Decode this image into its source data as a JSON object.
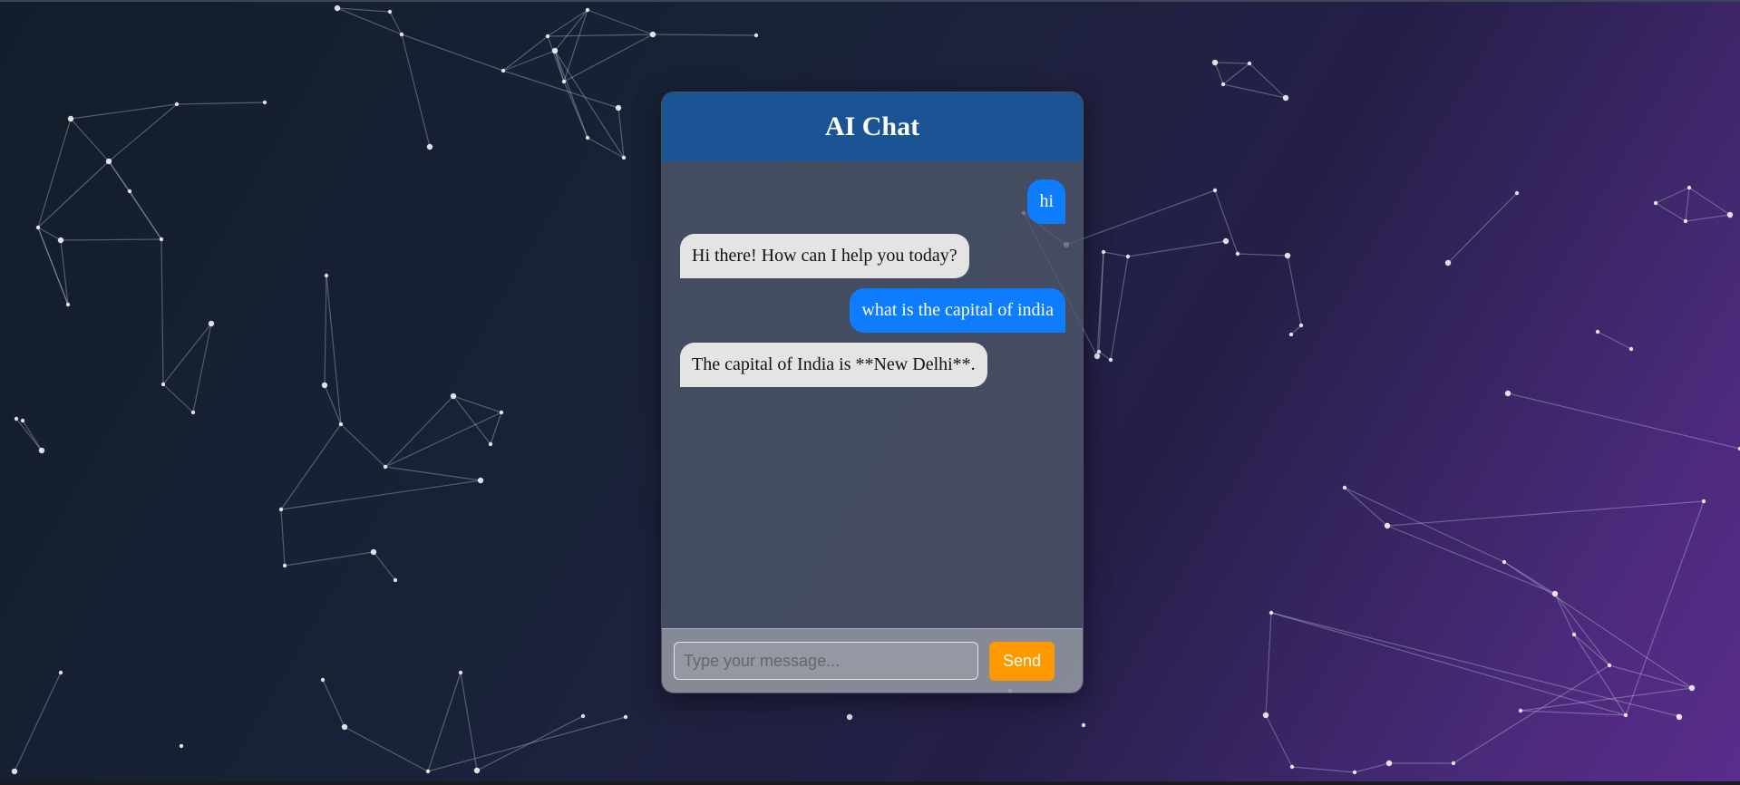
{
  "chat": {
    "title": "AI Chat",
    "messages": [
      {
        "role": "user",
        "text": "hi"
      },
      {
        "role": "bot",
        "text": "Hi there! How can I help you today?"
      },
      {
        "role": "user",
        "text": "what is the capital of india"
      },
      {
        "role": "bot",
        "text": "The capital of India is **New Delhi**."
      }
    ],
    "input": {
      "placeholder": "Type your message...",
      "value": ""
    },
    "send_label": "Send"
  },
  "colors": {
    "header": "#1a5494",
    "user_bubble": "#0d7dfd",
    "bot_bubble": "#e4e4e4",
    "send_button": "#ff9900"
  }
}
